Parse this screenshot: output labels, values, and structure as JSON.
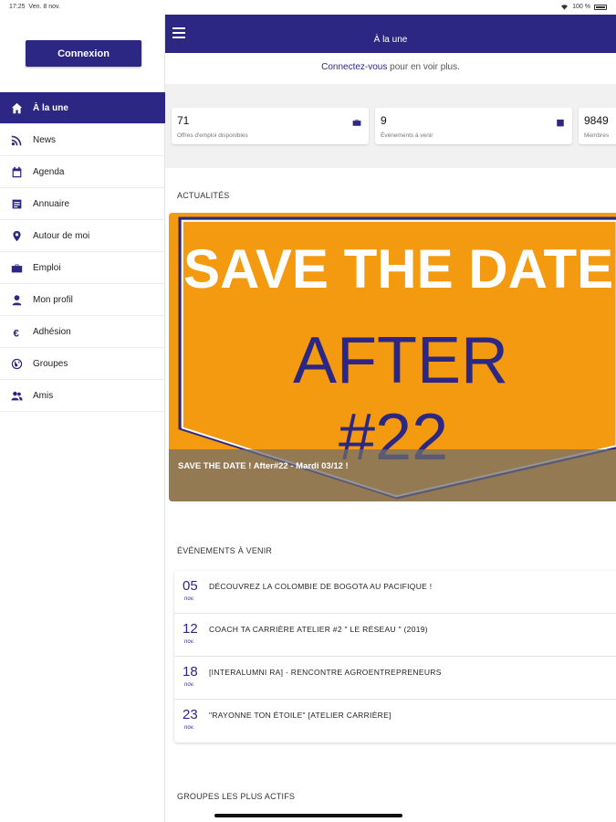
{
  "status_bar": {
    "time": "17:25",
    "date": "Ven. 8 nov.",
    "battery": "100 %"
  },
  "sidebar": {
    "login_button": "Connexion",
    "items": [
      {
        "label": "À la une",
        "icon": "home-icon",
        "active": true
      },
      {
        "label": "News",
        "icon": "rss-icon",
        "active": false
      },
      {
        "label": "Agenda",
        "icon": "calendar-icon",
        "active": false
      },
      {
        "label": "Annuaire",
        "icon": "directory-icon",
        "active": false
      },
      {
        "label": "Autour de moi",
        "icon": "map-pin-icon",
        "active": false
      },
      {
        "label": "Emploi",
        "icon": "briefcase-icon",
        "active": false
      },
      {
        "label": "Mon profil",
        "icon": "person-icon",
        "active": false
      },
      {
        "label": "Adhésion",
        "icon": "euro-icon",
        "active": false
      },
      {
        "label": "Groupes",
        "icon": "globe-icon",
        "active": false
      },
      {
        "label": "Amis",
        "icon": "friends-icon",
        "active": false
      }
    ]
  },
  "header": {
    "title": "À la une",
    "menu_icon": "hamburger-icon"
  },
  "connect": {
    "link": "Connectez-vous",
    "rest": " pour en voir plus."
  },
  "stats": [
    {
      "value": "71",
      "label": "Offres d'emploi disponibles",
      "icon": "briefcase-icon"
    },
    {
      "value": "9",
      "label": "Événements à venir",
      "icon": "calendar-icon"
    },
    {
      "value": "9849",
      "label": "Membres",
      "icon": ""
    }
  ],
  "news": {
    "section_title": "ACTUALITÉS",
    "banner_line1": "SAVE THE DATE",
    "banner_line2": "AFTER",
    "banner_line3": "#22",
    "caption": "SAVE THE DATE ! After#22 - Mardi 03/12 !",
    "colors": {
      "banner_bg": "#f39a11",
      "banner_text": "#2c2782"
    }
  },
  "events": {
    "section_title": "ÉVÉNEMENTS À VENIR",
    "items": [
      {
        "day": "05",
        "month": "nov.",
        "title": "DÉCOUVREZ LA COLOMBIE DE BOGOTA AU PACIFIQUE !"
      },
      {
        "day": "12",
        "month": "nov.",
        "title": "COACH TA CARRIÈRE ATELIER #2 \" LE RÉSEAU \" (2019)"
      },
      {
        "day": "18",
        "month": "nov.",
        "title": "[INTERALUMNI RA] - RENCONTRE AGROENTREPRENEURS"
      },
      {
        "day": "23",
        "month": "nov.",
        "title": "\"RAYONNE TON ÉTOILE\" [ATELIER CARRIÈRE]"
      }
    ]
  },
  "groups": {
    "section_title": "GROUPES LES PLUS ACTIFS"
  },
  "theme": {
    "primary": "#2c2782"
  }
}
